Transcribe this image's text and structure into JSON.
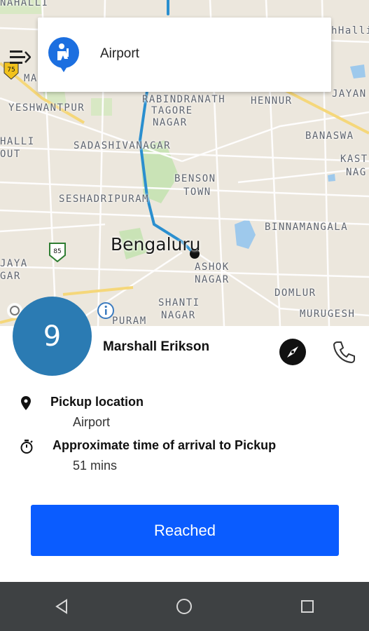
{
  "map": {
    "search_place": "Airport",
    "city": "Bengaluru",
    "route_badges": [
      "75",
      "85"
    ],
    "labels": [
      {
        "text": "NAHALLI",
        "id": "nahalli"
      },
      {
        "text": "hHalli",
        "id": "hhalli"
      },
      {
        "text": "MA",
        "id": "ma"
      },
      {
        "text": "RABINDRANATH",
        "id": "rabindranath"
      },
      {
        "text": "TAGORE",
        "id": "tagore"
      },
      {
        "text": "NAGAR",
        "id": "nagar1"
      },
      {
        "text": "JAYAN",
        "id": "jayan"
      },
      {
        "text": "YESHWANTPUR",
        "id": "yeshwantpur"
      },
      {
        "text": "HENNUR",
        "id": "hennur"
      },
      {
        "text": "HALLI",
        "id": "halli"
      },
      {
        "text": "OUT",
        "id": "out"
      },
      {
        "text": "SADASHIVANAGAR",
        "id": "sadashivanagar"
      },
      {
        "text": "BANASWA",
        "id": "banaswa"
      },
      {
        "text": "KAST",
        "id": "kast"
      },
      {
        "text": "NAG",
        "id": "nag"
      },
      {
        "text": "BENSON",
        "id": "benson"
      },
      {
        "text": "TOWN",
        "id": "town"
      },
      {
        "text": "SESHADRIPURAM",
        "id": "seshadripuram"
      },
      {
        "text": "BINNAMANGALA",
        "id": "binnamangala"
      },
      {
        "text": "JAYA",
        "id": "jaya"
      },
      {
        "text": "GAR",
        "id": "gar"
      },
      {
        "text": "ASHOK",
        "id": "ashok"
      },
      {
        "text": "NAGAR",
        "id": "nagar2"
      },
      {
        "text": "DOMLUR",
        "id": "domlur"
      },
      {
        "text": "SHANTI",
        "id": "shanti"
      },
      {
        "text": "NAGAR",
        "id": "nagar3"
      },
      {
        "text": "MURUGESH",
        "id": "murugesh"
      },
      {
        "text": "PURAM",
        "id": "puram"
      }
    ]
  },
  "driver": {
    "avatar_number": "9",
    "name": "Marshall Erikson"
  },
  "pickup": {
    "title": "Pickup location",
    "value": "Airport"
  },
  "eta": {
    "title": "Approximate time of arrival to Pickup",
    "value": "51 mins"
  },
  "actions": {
    "reached_label": "Reached"
  },
  "icons": {
    "menu": "menu-icon",
    "compass": "compass-icon",
    "phone": "phone-icon",
    "location": "location-pin-icon",
    "timer": "stopwatch-icon",
    "nav_back": "back-triangle-icon",
    "nav_home": "home-circle-icon",
    "nav_recent": "recent-square-icon"
  },
  "colors": {
    "avatar": "#2b7bb3",
    "primary_button": "#0a5cff",
    "route": "#2a8fcf",
    "nav_bar": "#3e4143"
  }
}
